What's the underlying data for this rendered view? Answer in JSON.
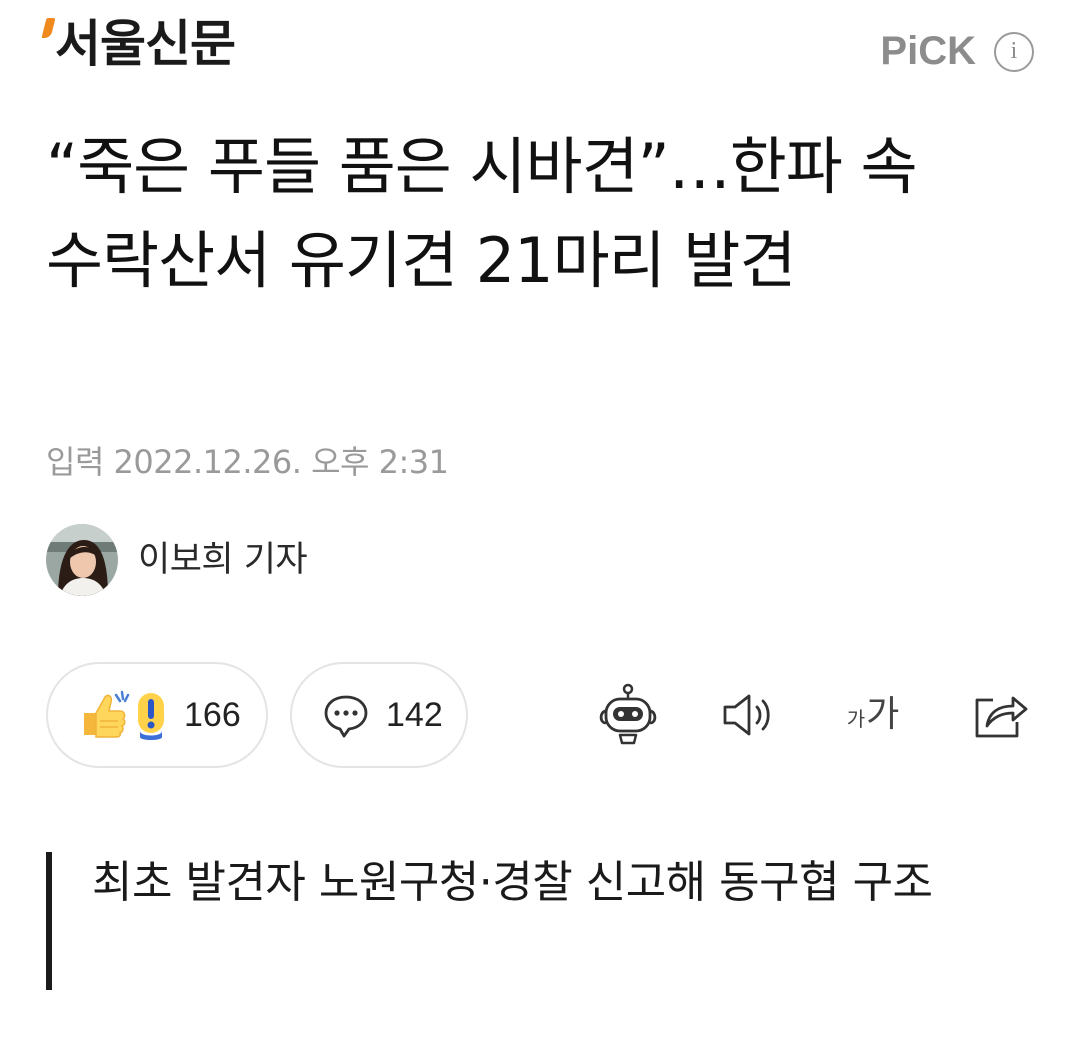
{
  "header": {
    "logo_text": "서울신문",
    "pick_label": "PiCK",
    "info_icon_glyph": "i",
    "brand_accent_color": "#f08a1d"
  },
  "article": {
    "title": "“죽은 푸들 품은 시바견”…한파 속 수락산서 유기견 21마리 발견",
    "date_text": "입력 2022.12.26. 오후 2:31",
    "author_name": "이보희 기자",
    "subtitle": "최초 발견자 노원구청·경찰 신고해 동구협 구조"
  },
  "actions": {
    "reaction_count": "166",
    "comment_count": "142",
    "font_size_small": "가",
    "font_size_big": "가",
    "icons": [
      "thumbs-up-icon",
      "exclamation-icon",
      "comment-bubble-icon",
      "ai-robot-icon",
      "speaker-icon",
      "font-size-icon",
      "share-icon"
    ]
  }
}
